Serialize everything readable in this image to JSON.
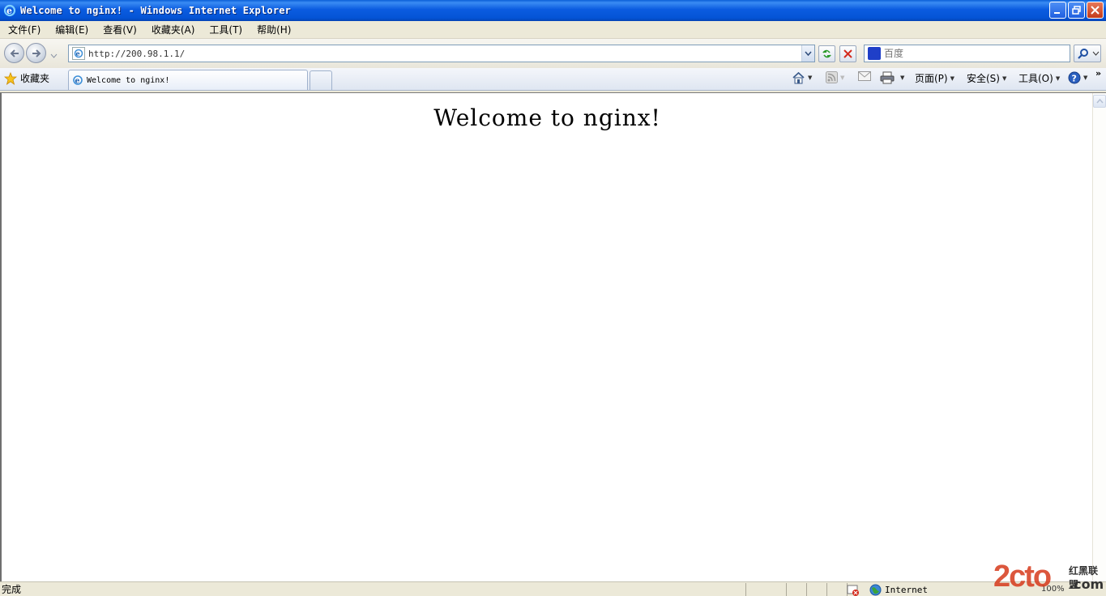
{
  "window": {
    "title": "Welcome to nginx! - Windows Internet Explorer"
  },
  "menubar": {
    "items": [
      "文件(F)",
      "编辑(E)",
      "查看(V)",
      "收藏夹(A)",
      "工具(T)",
      "帮助(H)"
    ]
  },
  "address": {
    "url": "http://200.98.1.1/"
  },
  "search": {
    "placeholder": "百度"
  },
  "tabbar": {
    "favorites_label": "收藏夹",
    "tab_title": "Welcome to nginx!",
    "commands": {
      "page": "页面(P)",
      "safety": "安全(S)",
      "tools": "工具(O)"
    }
  },
  "page": {
    "heading": "Welcome to nginx!"
  },
  "statusbar": {
    "text": "完成",
    "zone": "Internet",
    "zoom": "100%"
  },
  "watermark": {
    "brand": "2cto",
    "side_text": "红黑联盟",
    "suffix": ".com"
  },
  "colors": {
    "titlebar_blue": "#0454d6",
    "chrome_bg": "#ece9d8",
    "watermark_red": "#d63a1c"
  },
  "icons": [
    "ie-logo-icon",
    "minimize-icon",
    "restore-icon",
    "close-icon",
    "back-icon",
    "forward-icon",
    "refresh-icon",
    "stop-icon",
    "search-icon",
    "favorites-star-icon",
    "home-icon",
    "feeds-icon",
    "mail-icon",
    "print-icon",
    "help-icon",
    "globe-icon"
  ]
}
